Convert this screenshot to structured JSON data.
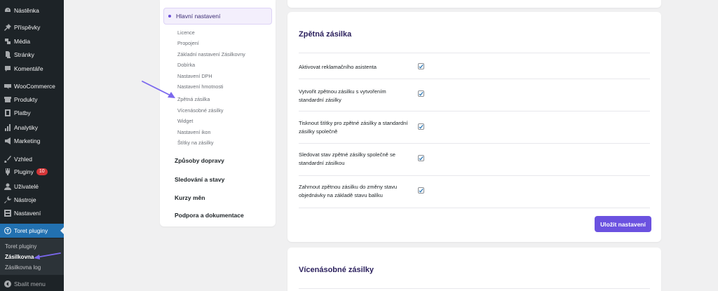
{
  "sidebar": {
    "items": [
      {
        "label": "Nástěnka",
        "icon": "dashboard-icon"
      },
      {
        "label": "Příspěvky",
        "icon": "pin-icon"
      },
      {
        "label": "Média",
        "icon": "media-icon"
      },
      {
        "label": "Stránky",
        "icon": "pages-icon"
      },
      {
        "label": "Komentáře",
        "icon": "comment-icon"
      },
      {
        "label": "WooCommerce",
        "icon": "woo-icon"
      },
      {
        "label": "Produkty",
        "icon": "archive-icon"
      },
      {
        "label": "Platby",
        "icon": "payment-icon"
      },
      {
        "label": "Analytiky",
        "icon": "chart-icon"
      },
      {
        "label": "Marketing",
        "icon": "megaphone-icon"
      },
      {
        "label": "Vzhled",
        "icon": "brush-icon"
      },
      {
        "label": "Pluginy",
        "icon": "plugin-icon",
        "badge": "10"
      },
      {
        "label": "Uživatelé",
        "icon": "users-icon"
      },
      {
        "label": "Nástroje",
        "icon": "wrench-icon"
      },
      {
        "label": "Nastavení",
        "icon": "settings-icon"
      },
      {
        "label": "Toret pluginy",
        "icon": "toret-icon"
      }
    ],
    "submenu": [
      "Toret pluginy",
      "Zásilkovna",
      "Zásilkovna log"
    ],
    "collapse_label": "Sbalit menu"
  },
  "nav": {
    "active": "Hlavní nastavení",
    "sub_items": [
      "Licence",
      "Propojení",
      "Základní nastavení Zásilkovny",
      "Dobírka",
      "Nastavení DPH",
      "Nastavení hmotnosti",
      "Zpětná zásilka",
      "Vícenásobné zásilky",
      "Widget",
      "Nastavení ikon",
      "Štítky na zásilky"
    ],
    "groups": [
      "Způsoby dopravy",
      "Sledování a stavy",
      "Kurzy měn",
      "Podpora a dokumentace"
    ]
  },
  "section": {
    "title": "Zpětná zásilka",
    "rows": [
      {
        "label": "Aktivovat reklamačního asistenta",
        "checked": true
      },
      {
        "label": "Vytvořit zpětnou zásilku s vytvořením standardní zásilky",
        "checked": true
      },
      {
        "label": "Tisknout štítky pro zpětné zásilky a standardní zásilky společně",
        "checked": true
      },
      {
        "label": "Sledovat stav zpětné zásilky společně se standardní zásilkou",
        "checked": true
      },
      {
        "label": "Zahrnout zpětnou zásilku do změny stavu objednávky na základě stavu balíku",
        "checked": true
      }
    ],
    "save_label": "Uložit nastavení"
  },
  "next_section": {
    "title": "Vícenásobné zásilky"
  },
  "colors": {
    "accent": "#6b52e0",
    "sidebar_bg": "#1d2327",
    "wp_blue": "#2271b1",
    "arrow": "#7b68ee"
  }
}
